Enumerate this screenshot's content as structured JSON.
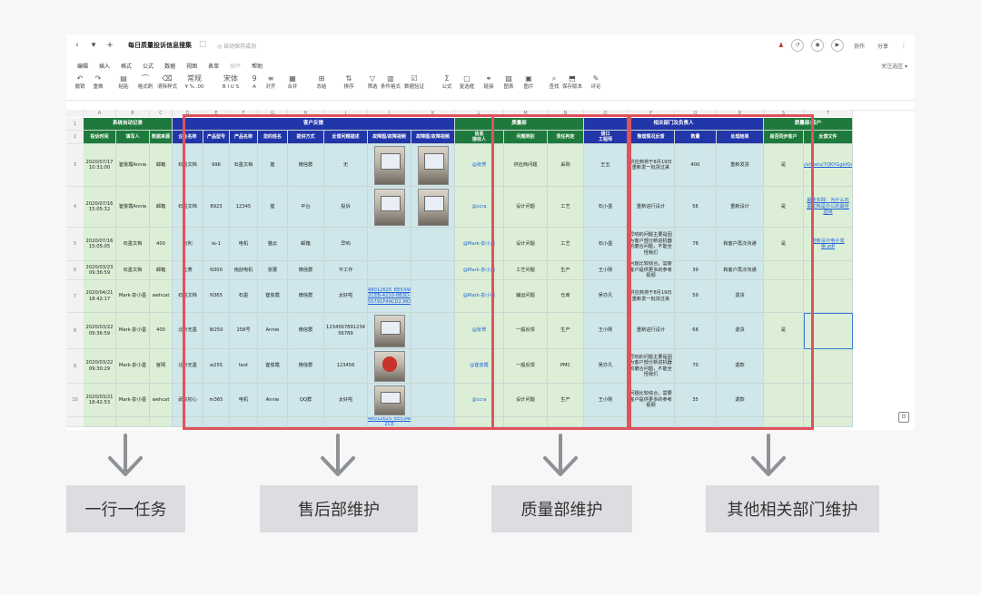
{
  "titlebar": {
    "back": "‹",
    "dropdown": "▾",
    "add": "+",
    "doc_title": "每日质量投诉信息搜集",
    "save_status": "◎ 自动保存成功",
    "collab": "协作",
    "share": "分享",
    "more": "⋮"
  },
  "menus": [
    "编辑",
    "插入",
    "格式",
    "公式",
    "数据",
    "视图",
    "表单",
    "插件",
    "帮助"
  ],
  "focus_mode": "关注选区 ▾",
  "toolbar": [
    {
      "g": "↶",
      "l": "撤销"
    },
    {
      "g": "↷",
      "l": "重做"
    },
    {
      "g": "▤",
      "l": "粘贴"
    },
    {
      "g": "⌒",
      "l": "格式刷"
    },
    {
      "g": "⌫",
      "l": "清除样式"
    },
    {
      "g": "常规",
      "l": "¥ % .00"
    },
    {
      "g": "宋体",
      "l": "B I U S"
    },
    {
      "g": "9",
      "l": "A"
    },
    {
      "g": "≡",
      "l": "对齐"
    },
    {
      "g": "▦",
      "l": "合并"
    },
    {
      "g": "⊞",
      "l": "冻结"
    },
    {
      "g": "⇅",
      "l": "排序"
    },
    {
      "g": "▽",
      "l": "筛选"
    },
    {
      "g": "▥",
      "l": "条件格式"
    },
    {
      "g": "☑",
      "l": "数据验证"
    },
    {
      "g": "Σ",
      "l": "公式"
    },
    {
      "g": "▢",
      "l": "复选框"
    },
    {
      "g": "⚭",
      "l": "链接"
    },
    {
      "g": "▨",
      "l": "图表"
    },
    {
      "g": "▣",
      "l": "图片"
    },
    {
      "g": "⌕",
      "l": "查找"
    },
    {
      "g": "⬒",
      "l": "保存版本"
    },
    {
      "g": "✎",
      "l": "评论"
    }
  ],
  "colors": {
    "green_header": "#1e7a3c",
    "blue_header": "#2136a8",
    "green_cell": "#dcefd6",
    "blue_cell": "#cfe6ea",
    "red_frame": "#e0525c"
  },
  "col_letters": [
    "A",
    "B",
    "C",
    "D",
    "E",
    "F",
    "G",
    "H",
    "I",
    "J",
    "K",
    "L",
    "M",
    "N",
    "O",
    "P",
    "Q",
    "R",
    "S",
    "T"
  ],
  "row_numbers": [
    "1",
    "2",
    "3",
    "4",
    "5",
    "6",
    "7",
    "8",
    "9",
    "10",
    ""
  ],
  "group_headers": [
    "系统自动记录",
    "客户反馈",
    "质量部",
    "相关部门及负责人",
    "质量部/客户"
  ],
  "headers": [
    "投诉时间",
    "填写人",
    "数据来源",
    "企业名称",
    "产品型号",
    "产品名称",
    "您的姓名",
    "提供方式",
    "反馈问题描述",
    "故障图/故障视频",
    "故障图/故障视频",
    "信息\n接收人",
    "问题类别",
    "责任判定",
    "接口\n工程师",
    "整理情况反馈",
    "数量",
    "处理结果",
    "是否同步客户",
    "反馈文件"
  ],
  "rows": [
    [
      "2020/07/17\n10:31:00",
      "崔俊霞Annie",
      "邮箱",
      "石墨文档",
      "996",
      "石墨文档",
      "崔",
      "微信群",
      "无",
      "",
      "",
      "@张贺",
      "供应商问题",
      "采购",
      "王五",
      "供应商将于8月19日重新发一批货过来",
      "400",
      "重新发货",
      "是",
      "https://shimo.im/sheets/7QKYGgkfQuh4Yb3D/EsHSQ"
    ],
    [
      "2020/07/16\n15:05:32",
      "崔俊霞Annie",
      "邮箱",
      "石墨文档",
      "8923",
      "12345",
      "崔",
      "平台",
      "投诉",
      "",
      "",
      "@ccra",
      "设计问题",
      "工艺",
      "石小墨",
      "重新进行设计",
      "56",
      "重新设计",
      "是",
      "最佳实践：为什么石墨文档是办公的最佳选择"
    ],
    [
      "2020/07/16\n15:05:05",
      "石墨文档",
      "400",
      "吉利",
      "le-1",
      "电机",
      "猫云",
      "邮箱",
      "异响",
      "",
      "",
      "@Mark-彭小墨",
      "设计问题",
      "工艺",
      "石小墨",
      "异响的问题主要是因为客户部分新进机器的磨合问题，不能全怪我们",
      "78",
      "和客户再次沟通",
      "是",
      "重新设计电子发票.pdf"
    ],
    [
      "2020/03/23\n09:36:59",
      "石墨文档",
      "邮箱",
      "五菱",
      "N300",
      "雨刮电机",
      "张蕾",
      "微信群",
      "不工作",
      "",
      "",
      "@Mark-彭小墨",
      "工艺问题",
      "生产",
      "王小刚",
      "问题比较综合，需要客户提供更多的参考视频",
      "39",
      "和客户再次沟通",
      "",
      ""
    ],
    [
      "2020/04/21\n18:42:17",
      "Mark-彭小墨",
      "wehcat",
      "石墨文档",
      "N365",
      "石墨",
      "崔俊霞",
      "微信群",
      "太好啦",
      "B0848012625_EE534A35-2CEB-4210-8B3D-655791F49CD2.MOV",
      "",
      "@Mark-彭小墨",
      "辅运问题",
      "仓库",
      "吴亦凡",
      "供应商将于8月19日重新发一批货过来",
      "59",
      "退货",
      "",
      ""
    ],
    [
      "2020/03/22\n09:36:59",
      "Mark-彭小墨",
      "400",
      "北京无墨",
      "W250",
      "258号",
      "Annie",
      "微信群",
      "1234567891234 56789",
      "",
      "",
      "@张贺",
      "一般反馈",
      "生产",
      "王小刚",
      "重新进行设计",
      "68",
      "退货",
      "是",
      ""
    ],
    [
      "2020/03/22\n09:30:29",
      "Mark-彭小墨",
      "官网",
      "北京无墨",
      "w255",
      "test",
      "崔俊霞",
      "微信群",
      "123456",
      "",
      "",
      "@崔俊霞",
      "一般反馈",
      "PMC",
      "吴亦凡",
      "异响的问题主要是因为客户部分新进机器的磨合问题，不能全怪我们",
      "70",
      "退款",
      "",
      ""
    ],
    [
      "2020/03/21\n18:42:53",
      "Mark-彭小墨",
      "wehcat",
      "武汉初心",
      "m365",
      "电机",
      "Annie",
      "QQ群",
      "太好啦",
      "",
      "",
      "@ccra",
      "设计问题",
      "生产",
      "王小刚",
      "问题比较综合，需要客户提供更多的参考视频",
      "35",
      "退款",
      "",
      ""
    ],
    [
      "",
      "",
      "",
      "",
      "",
      "",
      "",
      "",
      "",
      "B0848012625_EE534A35-2CE",
      "",
      "",
      "",
      "",
      "",
      "",
      "",
      "",
      "",
      ""
    ]
  ],
  "labels": [
    "一行一任务",
    "售后部维护",
    "质量部维护",
    "其他相关部门维护"
  ]
}
